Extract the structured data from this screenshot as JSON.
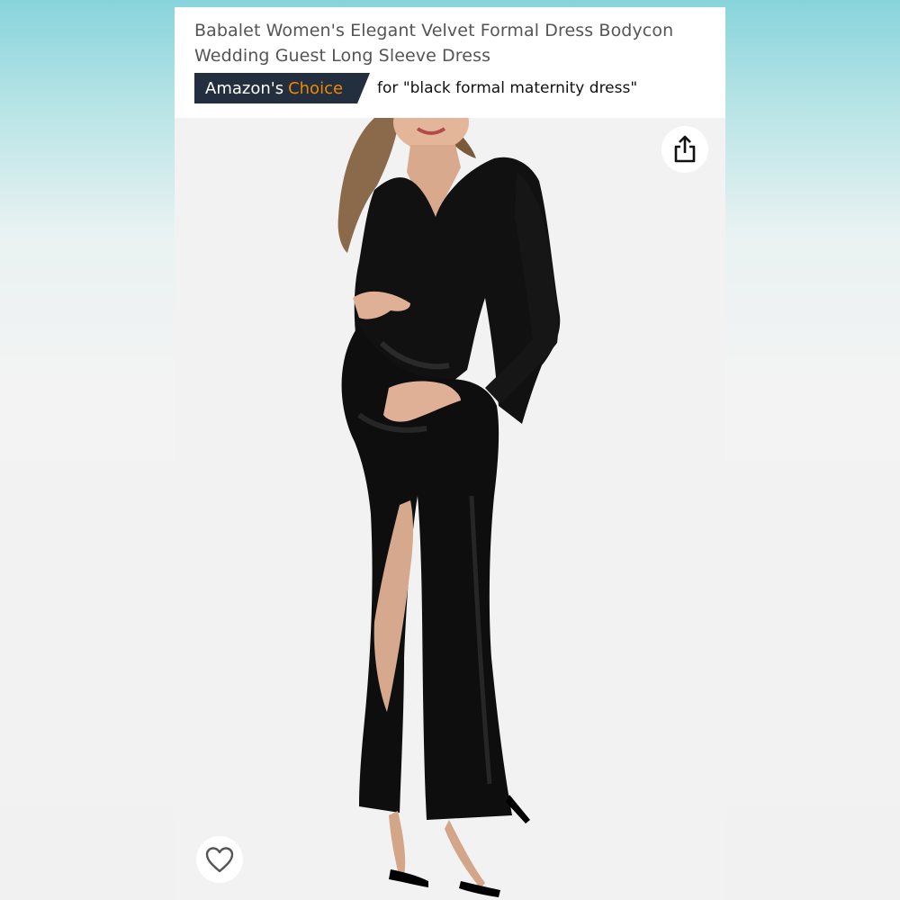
{
  "product": {
    "title": "Babalet Women's Elegant Velvet Formal Dress Bodycon Wedding Guest Long Sleeve Dress"
  },
  "badge": {
    "brand_text": "Amazon's",
    "choice_text": "Choice",
    "for_text": "for \"black formal maternity dress\"",
    "badge_color": "#232f3e",
    "accent_color": "#f08804"
  },
  "image": {
    "subject": "product-photo-black-velvet-maternity-dress"
  },
  "actions": {
    "share_icon": "share-icon",
    "favorite_icon": "heart-icon"
  }
}
